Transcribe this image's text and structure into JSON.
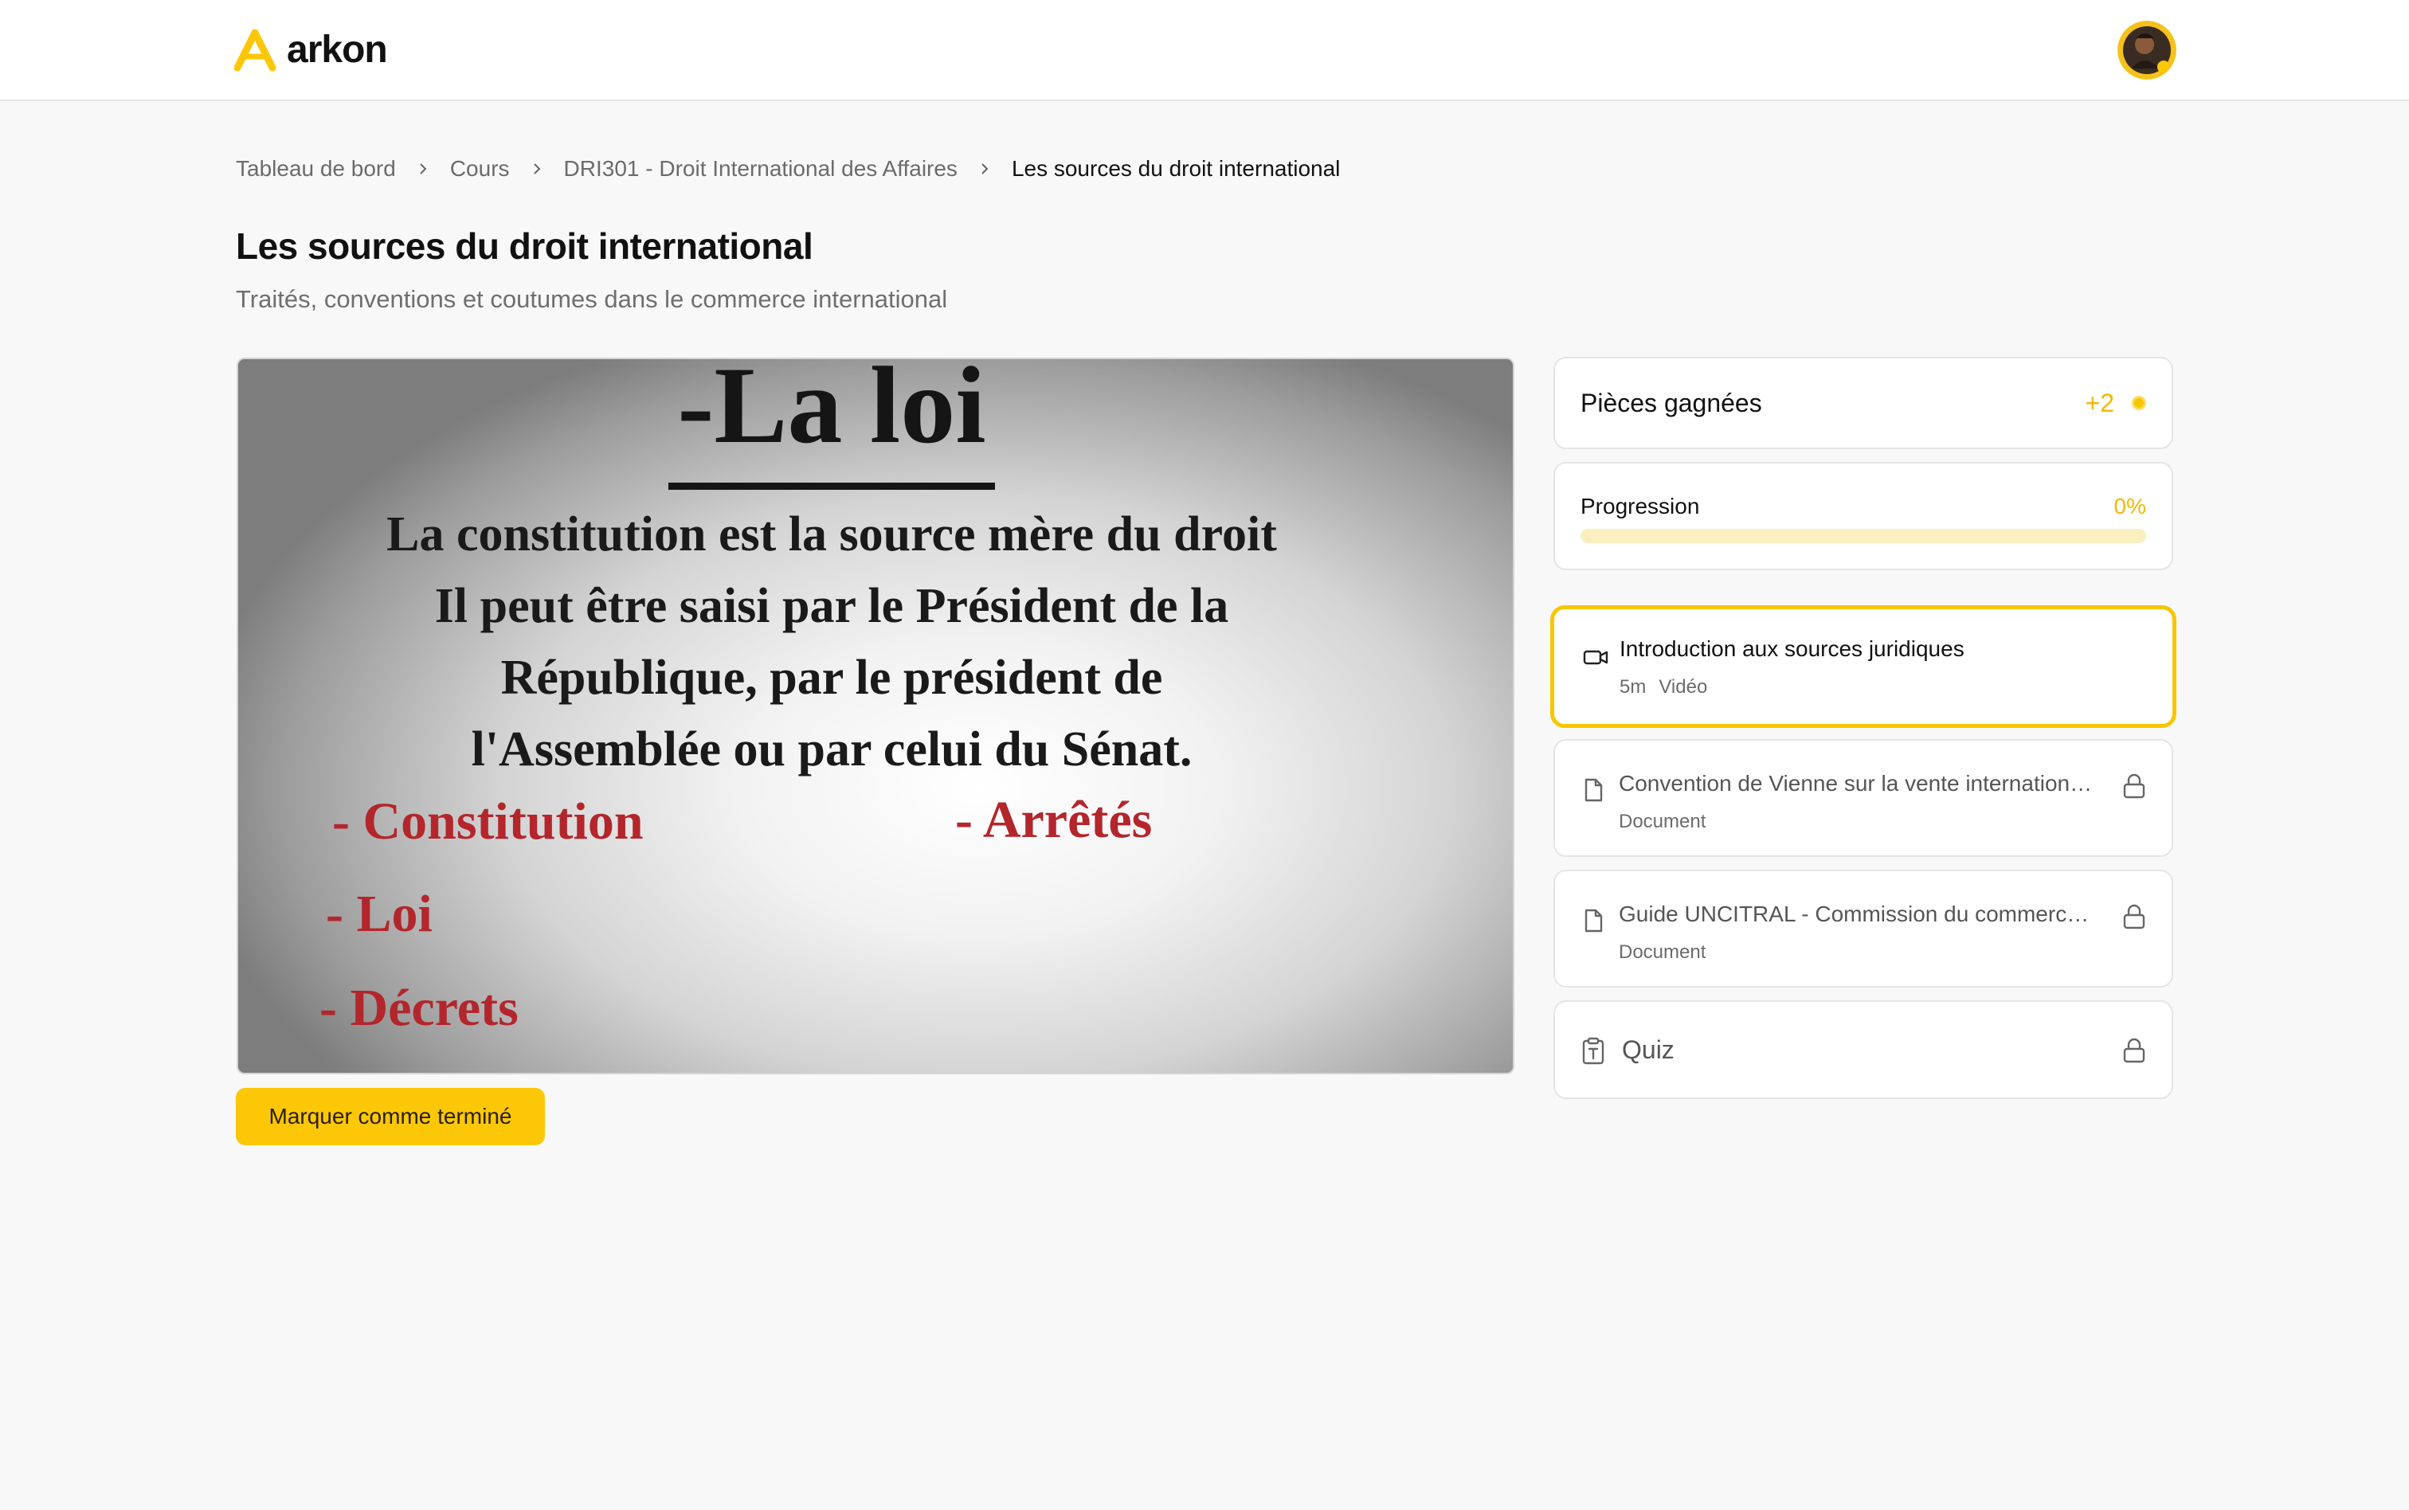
{
  "header": {
    "brand": "arkon",
    "brand_color": "#fcc707"
  },
  "breadcrumb": [
    {
      "label": "Tableau de bord"
    },
    {
      "label": "Cours"
    },
    {
      "label": "DRI301 - Droit International des Affaires"
    },
    {
      "label": "Les sources du droit international"
    }
  ],
  "page": {
    "title": "Les sources du droit international",
    "subtitle": "Traités, conventions et coutumes dans le commerce international"
  },
  "video": {
    "heading": "-La loi",
    "lines": [
      "La constitution est la source mère du droit",
      "Il peut être saisi par le Président de la",
      "République, par le président de",
      "l'Assemblée ou par celui du Sénat."
    ],
    "list_left": [
      "- Constitution",
      "- Loi",
      "- Décrets"
    ],
    "list_right": [
      "- Arrêtés"
    ]
  },
  "actions": {
    "mark_done": "Marquer comme terminé"
  },
  "sidebar": {
    "coins": {
      "label": "Pièces gagnées",
      "value": "+2"
    },
    "progress": {
      "label": "Progression",
      "value": "0%",
      "fraction": 0
    },
    "lessons": [
      {
        "title": "Introduction aux sources juridiques",
        "duration": "5m",
        "type": "Vidéo",
        "icon": "video-icon",
        "locked": false,
        "active": true
      },
      {
        "title": "Convention de Vienne sur la vente internationale de marchandises",
        "type": "Document",
        "icon": "document-icon",
        "locked": true,
        "active": false
      },
      {
        "title": "Guide UNCITRAL - Commission du commerce international",
        "type": "Document",
        "icon": "document-icon",
        "locked": true,
        "active": false
      }
    ],
    "quiz": {
      "title": "Quiz",
      "icon": "quiz-icon",
      "locked": true
    }
  }
}
